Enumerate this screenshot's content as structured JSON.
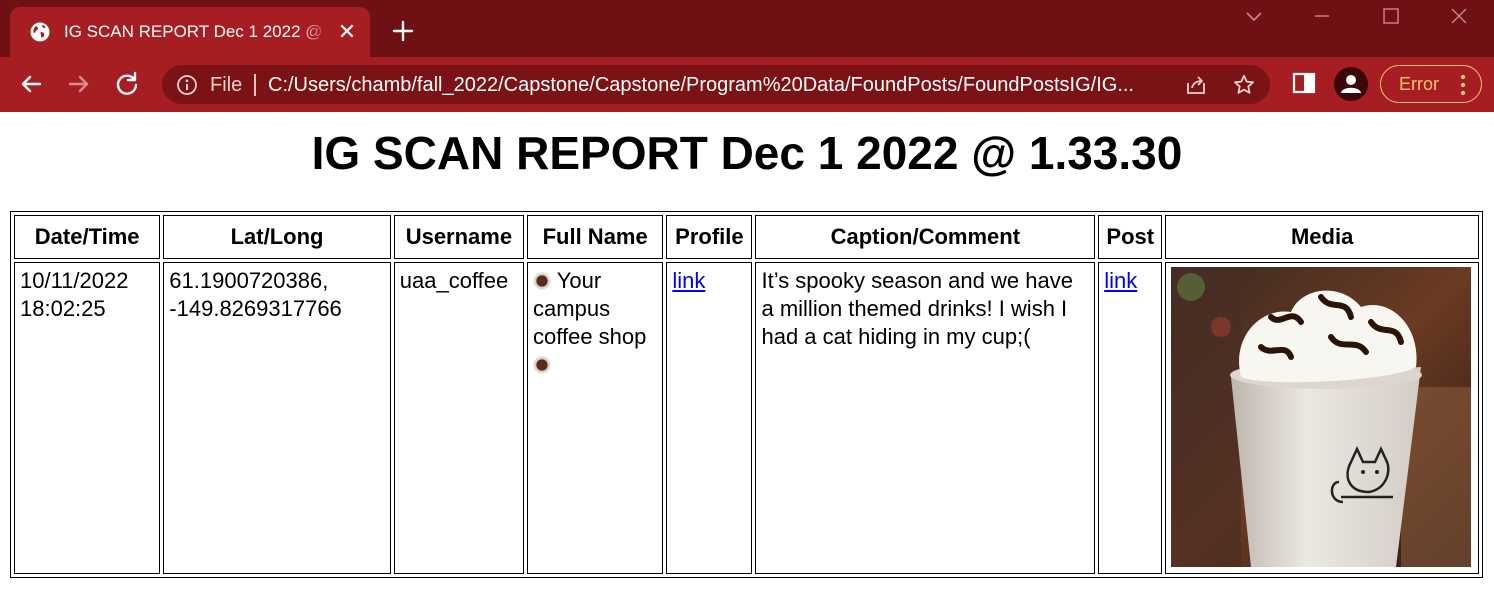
{
  "browser": {
    "tab_title": "IG SCAN REPORT Dec 1 2022 @ 1.33.30",
    "tab_close": "✕",
    "omnibox_scheme": "File",
    "url": "C:/Users/chamb/fall_2022/Capstone/Capstone/Program%20Data/FoundPosts/FoundPostsIG/IG...",
    "error_label": "Error",
    "accent_color": "#a61e22",
    "titlebar_color": "#6f1114"
  },
  "page": {
    "title": "IG SCAN REPORT Dec 1 2022 @ 1.33.30"
  },
  "table": {
    "headers": [
      "Date/Time",
      "Lat/Long",
      "Username",
      "Full Name",
      "Profile",
      "Caption/Comment",
      "Post",
      "Media"
    ],
    "row": {
      "date": "10/11/2022",
      "time": "18:02:25",
      "lat": "61.1900720386,",
      "long": "-149.8269317766",
      "username": "uaa_coffee",
      "fullname_text": "Your campus coffee shop",
      "profile_link": "link",
      "caption": "It’s spooky season and we have a million themed drinks! I wish I had a cat hiding in my cup;(",
      "post_link": "link",
      "media_icon": "coffee-cup-photo"
    }
  }
}
